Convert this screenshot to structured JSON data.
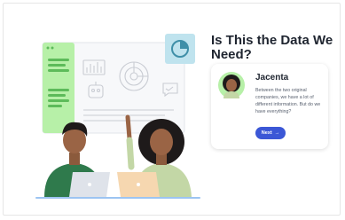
{
  "lesson": {
    "title": "Is This the Data We Need?"
  },
  "dialog": {
    "speaker_name": "Jacenta",
    "message": "Between the two original companies, we have a lot of different information. But do we have everything?",
    "next_label": "Next",
    "next_icon": "arrow-right-icon"
  },
  "colors": {
    "accent": "#3b57d6",
    "panel_green": "#b7f0a8",
    "chart_blue": "#bfe3ee",
    "text_dark": "#1f2530"
  }
}
